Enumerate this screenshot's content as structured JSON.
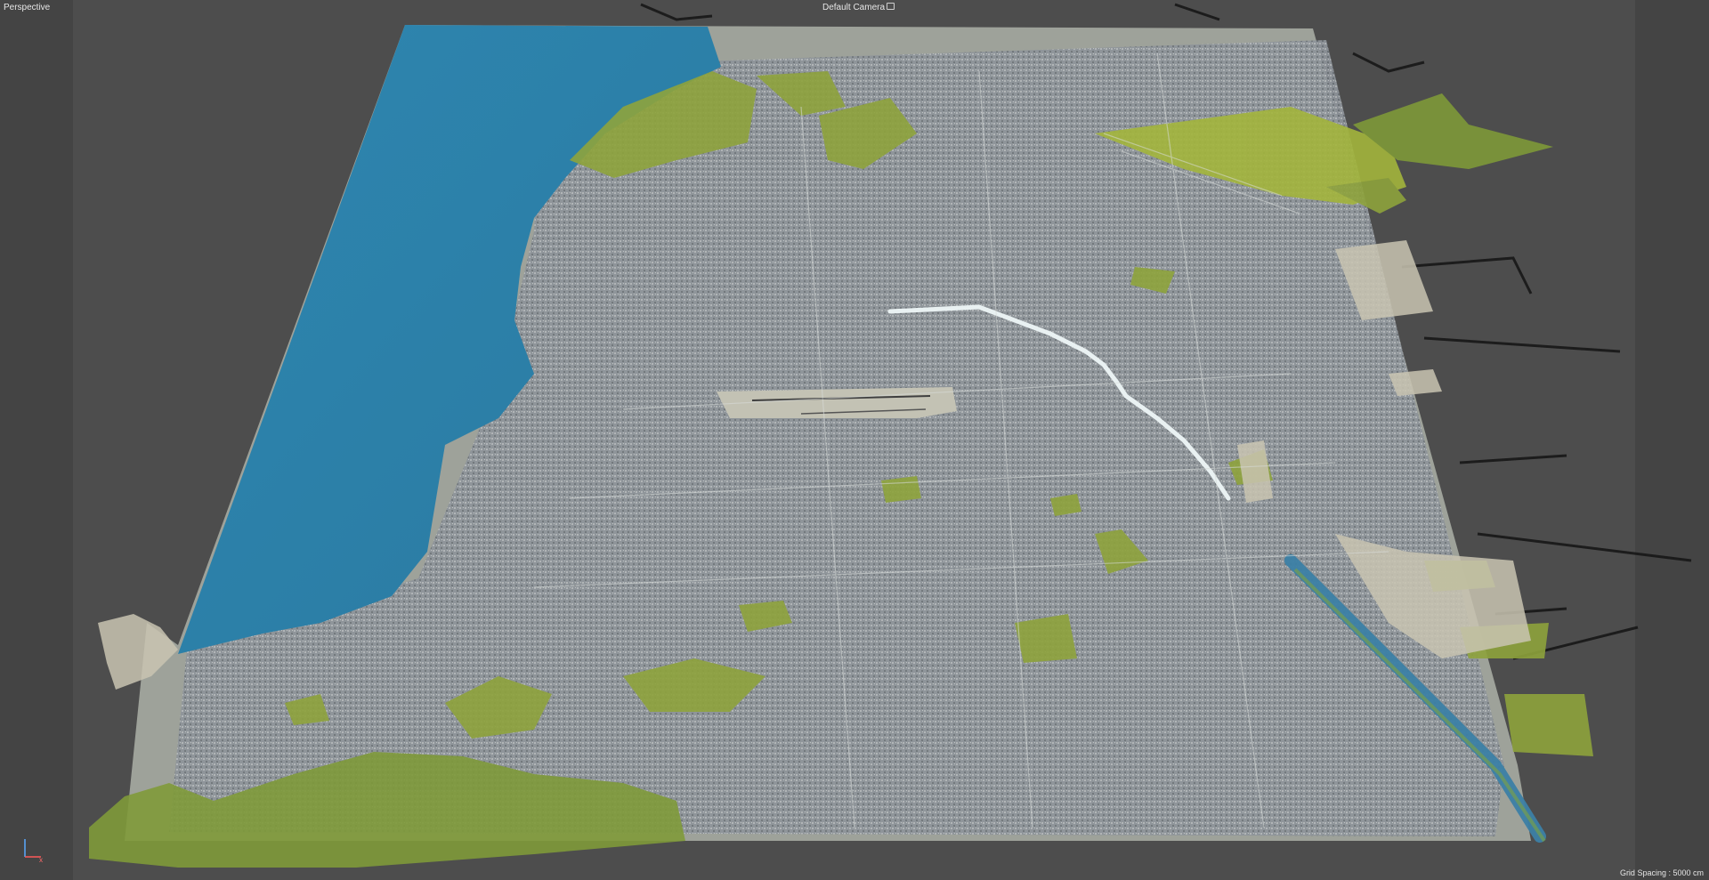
{
  "viewport": {
    "view_label": "Perspective",
    "camera_label": "Default Camera",
    "grid_spacing": "Grid Spacing : 5000 cm",
    "axis_x": "x"
  },
  "colors": {
    "background": "#444444",
    "safe_frame": "#4d4d4d",
    "sea": "#2e7fa7",
    "ground": "#9ea29a",
    "city": "#8d939a",
    "vegetation": "#8ea33c",
    "river": "#e8f0f0"
  },
  "icons": {
    "camera": "camera-icon",
    "axis_gizmo": "axis-gizmo-icon"
  }
}
